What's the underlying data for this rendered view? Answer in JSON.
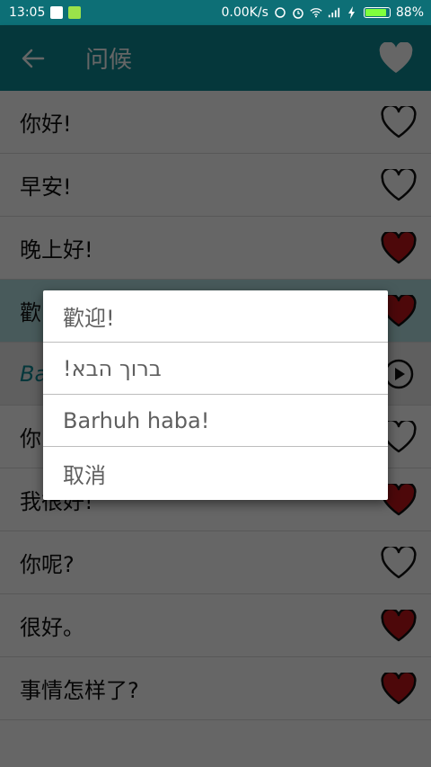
{
  "status_bar": {
    "time": "13:05",
    "network_speed": "0.00K/s",
    "battery_percent": "88%",
    "battery_level": 0.88,
    "icons": [
      "notification-icon",
      "wechat-icon",
      "sync-icon",
      "alarm-icon",
      "wifi-icon",
      "signal-icon",
      "charging-icon",
      "battery-icon"
    ]
  },
  "app_bar": {
    "title": "问候",
    "back_icon": "arrow-left-icon",
    "favorite_icon": "heart-icon"
  },
  "list": {
    "items": [
      {
        "text": "你好!",
        "favorited": false
      },
      {
        "text": "早安!",
        "favorited": false
      },
      {
        "text": "晚上好!",
        "favorited": true
      },
      {
        "text": "歡",
        "favorited": true
      },
      {
        "text": "Ba",
        "icon": "play-icon"
      },
      {
        "text": "你",
        "favorited": false
      },
      {
        "text": "我很好!",
        "favorited": true
      },
      {
        "text": "你呢?",
        "favorited": false
      },
      {
        "text": "很好。",
        "favorited": true
      },
      {
        "text": "事情怎样了?",
        "favorited": true
      }
    ]
  },
  "dialog": {
    "options": [
      "歡迎!",
      "ברוך הבא!",
      "Barhuh haba!",
      "取消"
    ]
  },
  "colors": {
    "status_bar": "#0d6f76",
    "app_bar": "#0e8a94",
    "heart_filled": "#c0161b",
    "heart_outline": "#111111"
  }
}
